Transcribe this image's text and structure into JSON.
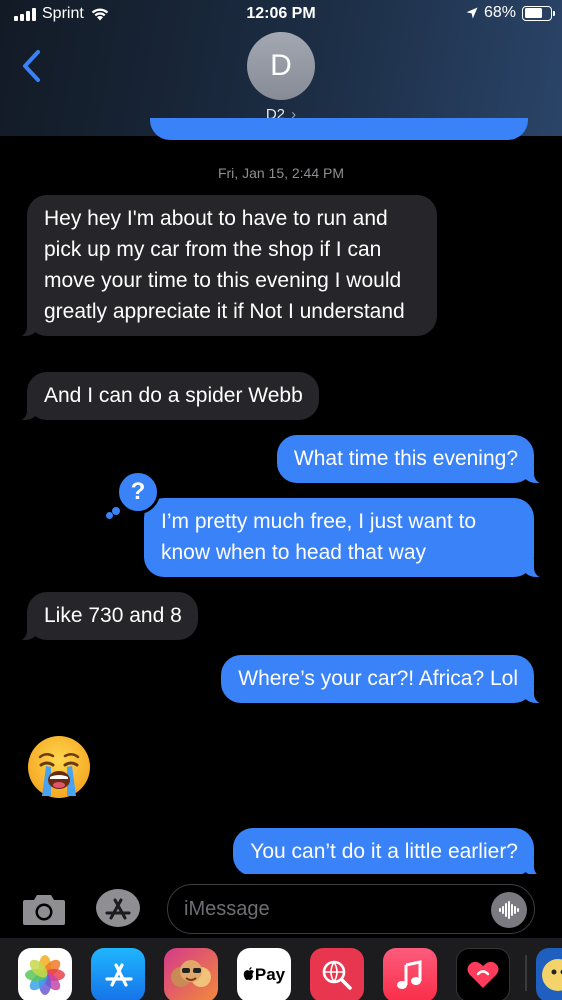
{
  "status_bar": {
    "carrier": "Sprint",
    "time": "12:06 PM",
    "battery_percent": "68%",
    "battery_level": 0.68
  },
  "header": {
    "avatar_initial": "D",
    "contact_name": "D2",
    "contact_chevron": "›"
  },
  "timestamp": "Fri, Jan 15, 2:44 PM",
  "messages": [
    {
      "from": "them",
      "text": "Hey hey I'm about to have to run and pick up my car from the shop if I can move your time to this evening I would greatly appreciate it if Not I understand"
    },
    {
      "from": "them",
      "text": "And I can do a spider Webb"
    },
    {
      "from": "me",
      "text": "What time this evening?"
    },
    {
      "from": "me",
      "text": "I’m pretty much free, I just want to know when to head that way",
      "reaction": "?"
    },
    {
      "from": "them",
      "text": "Like 730 and 8"
    },
    {
      "from": "me",
      "text": "Where’s your car?! Africa? Lol"
    },
    {
      "from": "them",
      "emoji": "loudly-crying-face"
    },
    {
      "from": "me",
      "text": "You can’t do it a little earlier?"
    }
  ],
  "input": {
    "placeholder": "iMessage"
  },
  "app_drawer": [
    {
      "name": "photos-app",
      "icon": "photos-icon",
      "color": "#ffffff"
    },
    {
      "name": "app-store-app",
      "icon": "app-store-icon",
      "color": "#1a8cf5"
    },
    {
      "name": "memoji-app",
      "icon": "memoji-icon",
      "color": "#d43a8a"
    },
    {
      "name": "apple-pay-app",
      "icon": "apple-pay-icon",
      "color": "#ffffff",
      "label": "Pay"
    },
    {
      "name": "search-images-app",
      "icon": "globe-search-icon",
      "color": "#e8364f"
    },
    {
      "name": "music-app",
      "icon": "music-note-icon",
      "color": "#fb3a58"
    },
    {
      "name": "digital-touch-app",
      "icon": "heart-touch-icon",
      "color": "#000000"
    },
    {
      "name": "sticker-app",
      "icon": "sticker-icon",
      "color": "#1f5fbf"
    }
  ],
  "colors": {
    "sent_bubble": "#3a82f7",
    "received_bubble": "#26262a",
    "background": "#000000"
  }
}
